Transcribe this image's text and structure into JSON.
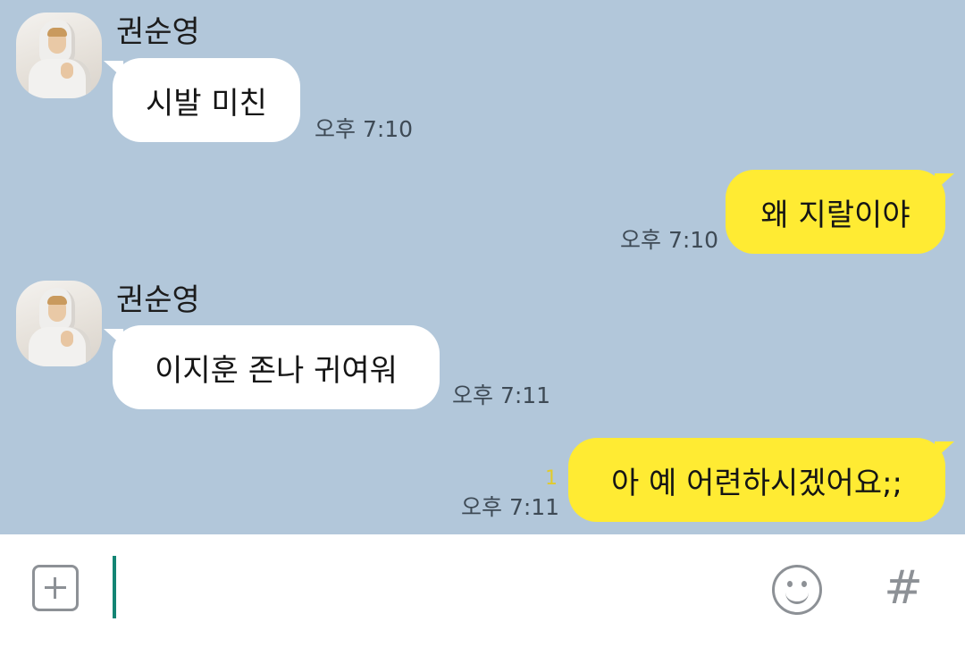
{
  "messages": [
    {
      "direction": "in",
      "sender": "권순영",
      "text": "시발 미친",
      "time": "오후 7:10"
    },
    {
      "direction": "out",
      "text": "왜 지랄이야",
      "time": "오후 7:10"
    },
    {
      "direction": "in",
      "sender": "권순영",
      "text": "이지훈 존나 귀여워",
      "time": "오후 7:11"
    },
    {
      "direction": "out",
      "text": "아 예 어련하시겠어요;;",
      "time": "오후 7:11",
      "unread": "1"
    }
  ],
  "input": {
    "value": "",
    "placeholder": ""
  },
  "icons": {
    "attach": "plus-box-icon",
    "emoticon": "smiley-icon",
    "hashtag": "hash-icon"
  },
  "colors": {
    "chat_background": "#b2c7da",
    "outgoing_bubble": "#ffeb33",
    "incoming_bubble": "#ffffff",
    "caret": "#138574"
  },
  "hash_symbol": "#"
}
